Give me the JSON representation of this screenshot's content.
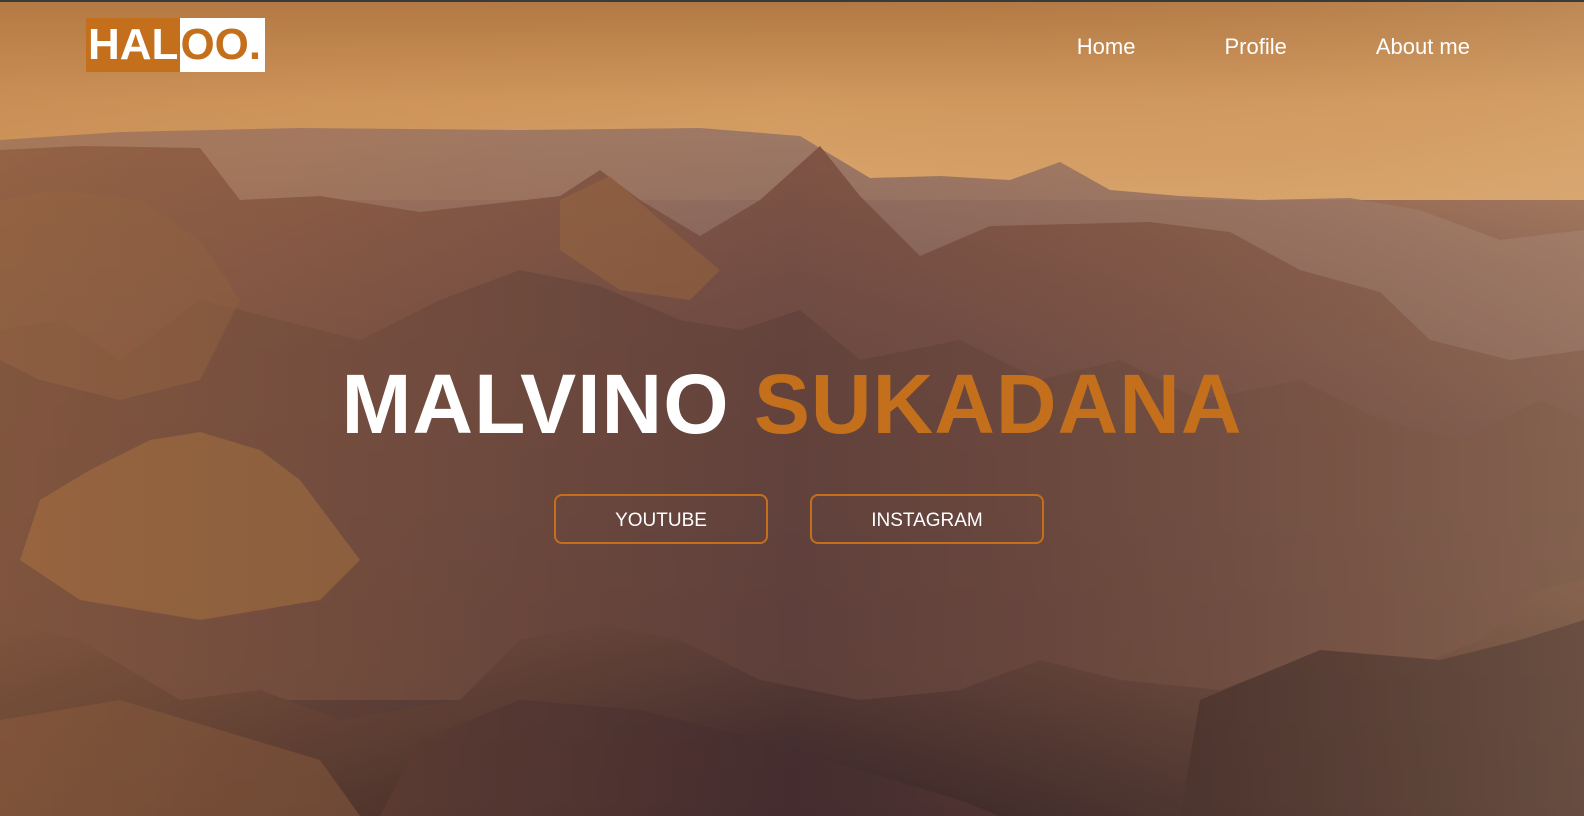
{
  "logo": {
    "part_a": "HAL",
    "part_b": "OO."
  },
  "nav": {
    "home": "Home",
    "profile": "Profile",
    "about": "About me"
  },
  "hero": {
    "first_name": "MALVINO",
    "last_name": "SUKADANA"
  },
  "buttons": {
    "youtube": "YOUTUBE",
    "instagram": "INSTAGRAM"
  },
  "colors": {
    "accent": "#c36f1c",
    "text": "#ffffff"
  }
}
